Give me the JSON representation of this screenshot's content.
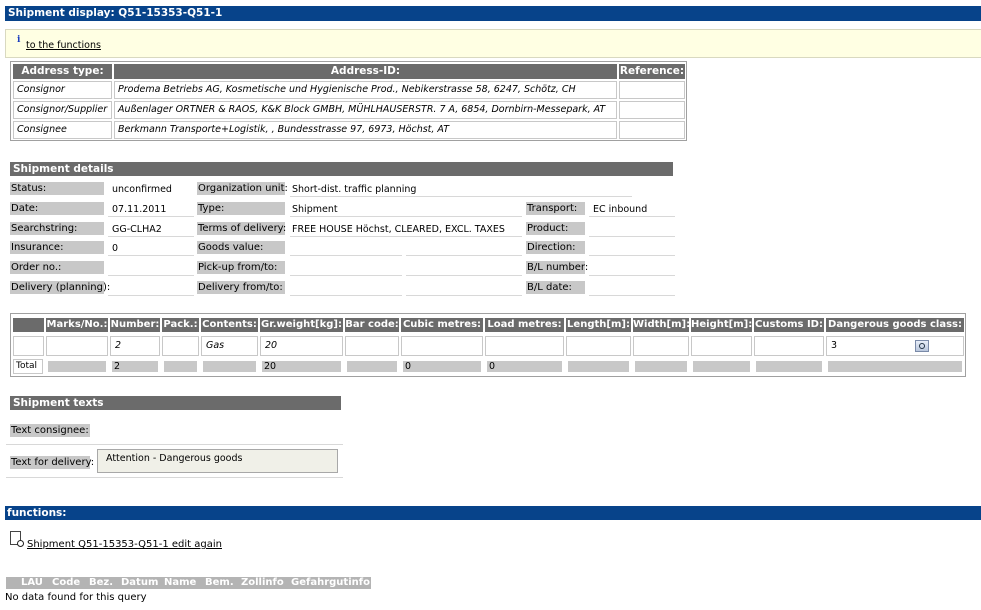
{
  "window": {
    "title": "Shipment display: Q51-15353-Q51-1"
  },
  "info": {
    "link_text": "to the functions"
  },
  "address_table": {
    "headers": [
      "Address type:",
      "Address-ID:",
      "Reference:"
    ],
    "rows": [
      {
        "type": "Consignor",
        "address": "Prodema Betriebs AG, Kosmetische und Hygienische Prod., Nebikerstrasse 58, 6247, Schötz, CH",
        "reference": ""
      },
      {
        "type": "Consignor/Supplier",
        "address": "Außenlager ORTNER & RAOS, K&K Block GMBH, MÜHLHAUSERSTR. 7 A, 6854, Dornbirn-Messepark, AT",
        "reference": ""
      },
      {
        "type": "Consignee",
        "address": "Berkmann Transporte+Logistik, , Bundesstrasse 97, 6973, Höchst, AT",
        "reference": ""
      }
    ]
  },
  "shipment_details": {
    "title": "Shipment details",
    "status_label": "Status:",
    "status": "unconfirmed",
    "org_unit_label": "Organization unit:",
    "org_unit": "Short-dist. traffic planning",
    "date_label": "Date:",
    "date": "07.11.2011",
    "type_label": "Type:",
    "type": "Shipment",
    "transport_label": "Transport:",
    "transport": "EC inbound",
    "searchstring_label": "Searchstring:",
    "searchstring": "GG-CLHA2",
    "terms_label": "Terms of delivery:",
    "terms": "FREE HOUSE Höchst, CLEARED, EXCL. TAXES",
    "product_label": "Product:",
    "product": "",
    "insurance_label": "Insurance:",
    "insurance": "0",
    "goods_value_label": "Goods value:",
    "goods_value": "",
    "direction_label": "Direction:",
    "direction": "",
    "order_no_label": "Order no.:",
    "order_no": "",
    "pickup_label": "Pick-up from/to:",
    "pickup": "",
    "bl_number_label": "B/L number:",
    "bl_number": "",
    "delivery_planning_label": "Delivery (planning):",
    "delivery_planning": "",
    "delivery_from_label": "Delivery from/to:",
    "delivery_from": "",
    "bl_date_label": "B/L date:",
    "bl_date": ""
  },
  "goods_table": {
    "headers": [
      "",
      "Marks/No.:",
      "Number:",
      "Pack.:",
      "Contents:",
      "Gr.weight[kg]:",
      "Bar code:",
      "Cubic metres:",
      "Load metres:",
      "Length[m]:",
      "Width[m]:",
      "Height[m]:",
      "Customs ID:",
      "Dangerous goods class:"
    ],
    "row": {
      "number": "2",
      "contents": "Gas",
      "weight": "20",
      "dg_class": "3"
    },
    "total": {
      "label": "Total",
      "number": "2",
      "weight": "20",
      "cubic": "0",
      "load": "0"
    }
  },
  "shipment_texts": {
    "title": "Shipment texts",
    "consignee_label": "Text consignee:",
    "delivery_label": "Text for delivery:",
    "delivery_text": "Attention - Dangerous goods"
  },
  "functions": {
    "title": "functions:",
    "edit_link": "Shipment Q51-15353-Q51-1 edit again",
    "columns": [
      "LAU",
      "Code",
      "Bez.",
      "Datum",
      "Name",
      "Bem.",
      "Zollinfo",
      "Gefahrgutinfo"
    ],
    "no_data": "No data found for this query"
  },
  "icons": [
    "info-icon",
    "lookup-icon",
    "document-search-icon"
  ],
  "colors": {
    "title_bar": "#07438a",
    "section_header": "#6b6b6b",
    "info_background": "#ffffe3",
    "label_background": "#c8c8c8"
  }
}
